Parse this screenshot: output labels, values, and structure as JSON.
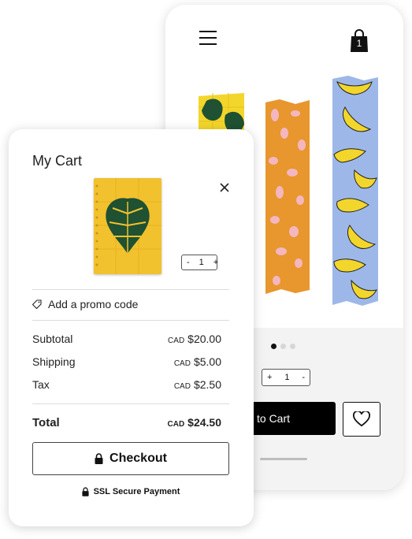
{
  "phone": {
    "cart_count": "1",
    "qty_minus": "+",
    "qty_value": "1",
    "qty_plus": "-",
    "add_to_cart_label": "to Cart",
    "carousel_dots": 3
  },
  "cart": {
    "title": "My Cart",
    "item_qty_minus": "-",
    "item_qty_value": "1",
    "item_qty_plus": "+",
    "promo_label": "Add a promo code",
    "subtotal_label": "Subtotal",
    "subtotal_currency": "CAD",
    "subtotal_value": "$20.00",
    "shipping_label": "Shipping",
    "shipping_currency": "CAD",
    "shipping_value": "$5.00",
    "tax_label": "Tax",
    "tax_currency": "CAD",
    "tax_value": "$2.50",
    "total_label": "Total",
    "total_currency": "CAD",
    "total_value": "$24.50",
    "checkout_label": "Checkout",
    "ssl_label": "SSL Secure Payment"
  },
  "colors": {
    "notebook": "#f2c12e",
    "tape_orange": "#e8962e",
    "tape_blue": "#9db8e8",
    "banana": "#f3d62b",
    "leaf": "#1f5132",
    "primary_button": "#000000"
  }
}
